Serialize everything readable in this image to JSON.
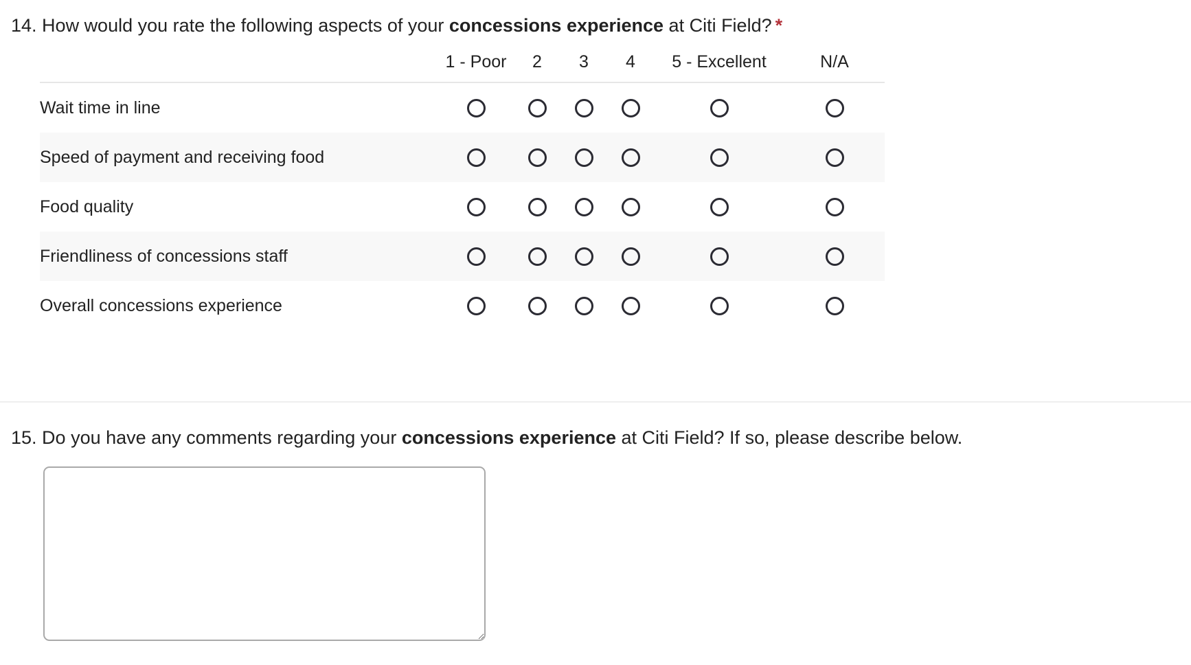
{
  "question14": {
    "number": "14.",
    "text_before_bold": " How would you rate the following aspects of your ",
    "bold_text": "concessions experience",
    "text_after_bold": " at Citi Field?",
    "required_marker": "*",
    "required_color": "#b3323a"
  },
  "matrix": {
    "column_headers": [
      "1 - Poor",
      "2",
      "3",
      "4",
      "5 - Excellent",
      "N/A"
    ],
    "rows": [
      {
        "label": "Wait time in line",
        "selected": null
      },
      {
        "label": "Speed of payment and receiving food",
        "selected": null
      },
      {
        "label": "Food quality",
        "selected": null
      },
      {
        "label": "Friendliness of concessions staff",
        "selected": null
      },
      {
        "label": "Overall concessions experience",
        "selected": null
      }
    ],
    "band_color": "#f8f8f8",
    "header_rule_color": "#e6e6e6",
    "radio_border_color": "#2b2b33"
  },
  "divider": {
    "color": "#eeeeee"
  },
  "question15": {
    "number": "15.",
    "text_before_bold": " Do you have any comments regarding your ",
    "bold_text": "concessions experience",
    "text_after_bold": " at Citi Field? If so, please describe below."
  },
  "comment_field": {
    "value": "",
    "placeholder": "",
    "border_color": "#a9a9a9"
  }
}
